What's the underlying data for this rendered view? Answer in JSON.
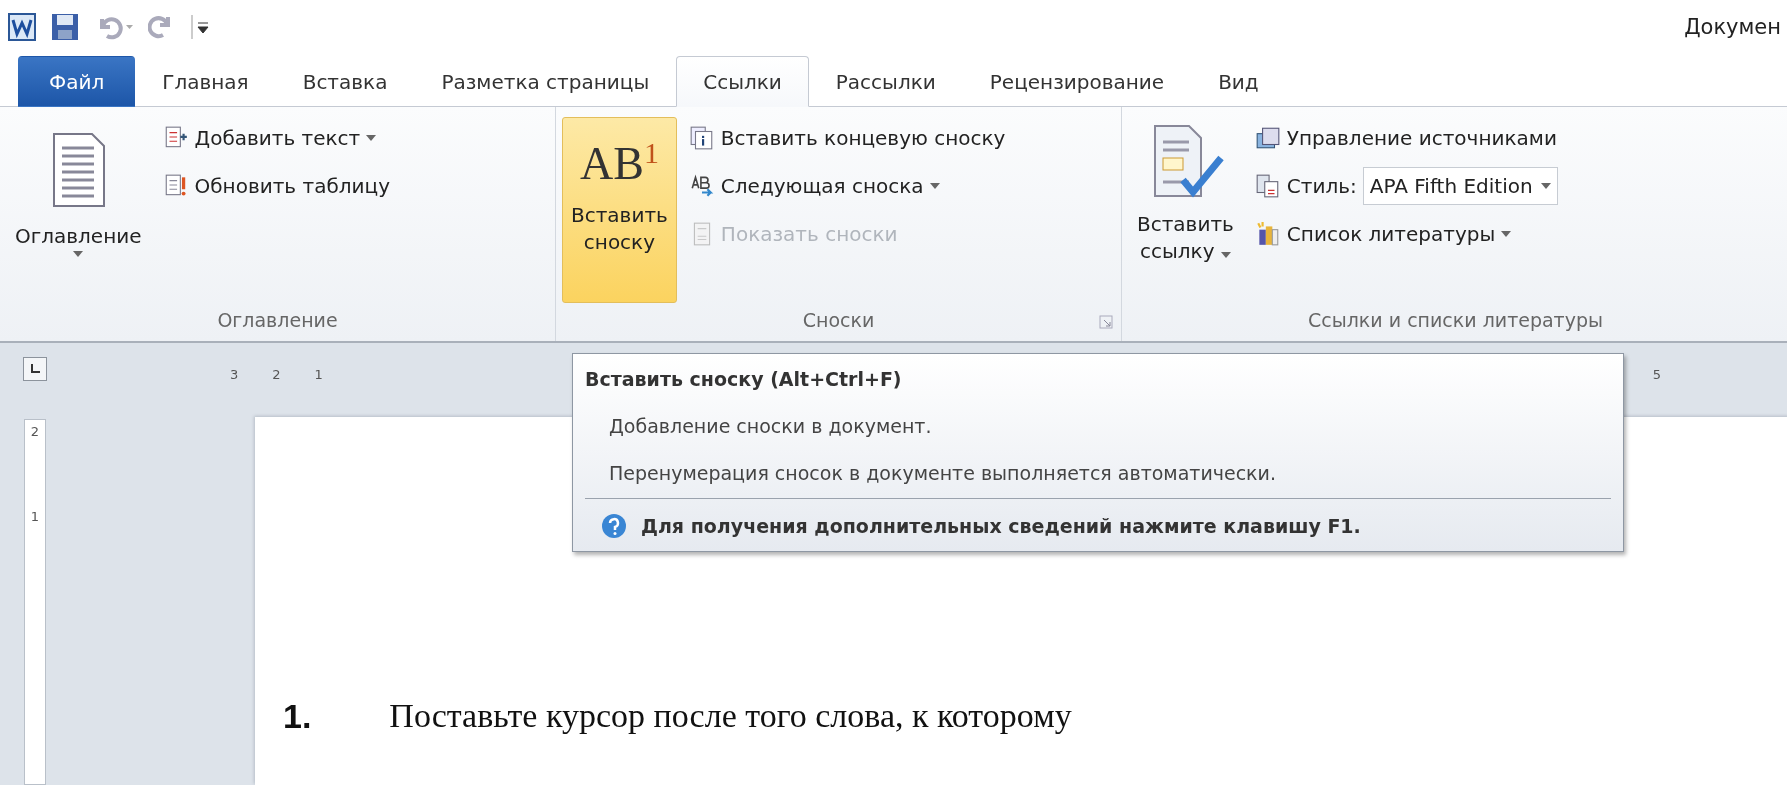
{
  "title_bar": {
    "title": "Докумен"
  },
  "tabs": [
    {
      "label": "Файл",
      "kind": "file",
      "selected": false
    },
    {
      "label": "Главная",
      "kind": "tab",
      "selected": false
    },
    {
      "label": "Вставка",
      "kind": "tab",
      "selected": false
    },
    {
      "label": "Разметка страницы",
      "kind": "tab",
      "selected": false
    },
    {
      "label": "Ссылки",
      "kind": "tab",
      "selected": true
    },
    {
      "label": "Рассылки",
      "kind": "tab",
      "selected": false
    },
    {
      "label": "Рецензирование",
      "kind": "tab",
      "selected": false
    },
    {
      "label": "Вид",
      "kind": "tab",
      "selected": false
    }
  ],
  "ribbon": {
    "groups": [
      {
        "label": "Оглавление",
        "large": {
          "lines": [
            "Оглавление"
          ],
          "dropdown": true,
          "highlighted": false
        },
        "items": [
          {
            "label": "Добавить текст",
            "kind": "command",
            "dropdown": true,
            "disabled": false
          },
          {
            "label": "Обновить таблицу",
            "kind": "command",
            "disabled": false
          }
        ]
      },
      {
        "label": "Сноски",
        "launcher": true,
        "large": {
          "lines": [
            "Вставить",
            "сноску"
          ],
          "glyph": "AB",
          "sup": "1",
          "highlighted": true
        },
        "items": [
          {
            "label": "Вставить концевую сноску",
            "kind": "command",
            "disabled": false
          },
          {
            "label": "Следующая сноска",
            "kind": "command",
            "dropdown": true,
            "disabled": false
          },
          {
            "label": "Показать сноски",
            "kind": "command",
            "disabled": true
          }
        ]
      },
      {
        "label": "Ссылки и списки литературы",
        "large": {
          "lines": [
            "Вставить",
            "ссылку"
          ],
          "dropdown": true,
          "highlighted": false
        },
        "items": [
          {
            "label": "Управление источниками",
            "kind": "command",
            "disabled": false
          },
          {
            "label": "Стиль:",
            "kind": "combo",
            "value": "APA Fifth Edition",
            "dropdown": true
          },
          {
            "label": "Список литературы",
            "kind": "command",
            "dropdown": true,
            "disabled": false
          }
        ]
      }
    ]
  },
  "ruler": {
    "left_numbers": [
      "3",
      "2",
      "1"
    ],
    "right_numbers": [
      "5"
    ],
    "vertical_numbers": [
      "2",
      "1"
    ]
  },
  "tooltip": {
    "title": "Вставить сноску (Alt+Ctrl+F)",
    "lines": [
      "Добавление сноски в документ.",
      "Перенумерация сносок в документе выполняется автоматически."
    ],
    "help": "Для получения дополнительных сведений нажмите клавишу F1."
  },
  "slide_text": {
    "number": "1.",
    "text": "Поставьте курсор после того слова, к которому"
  }
}
